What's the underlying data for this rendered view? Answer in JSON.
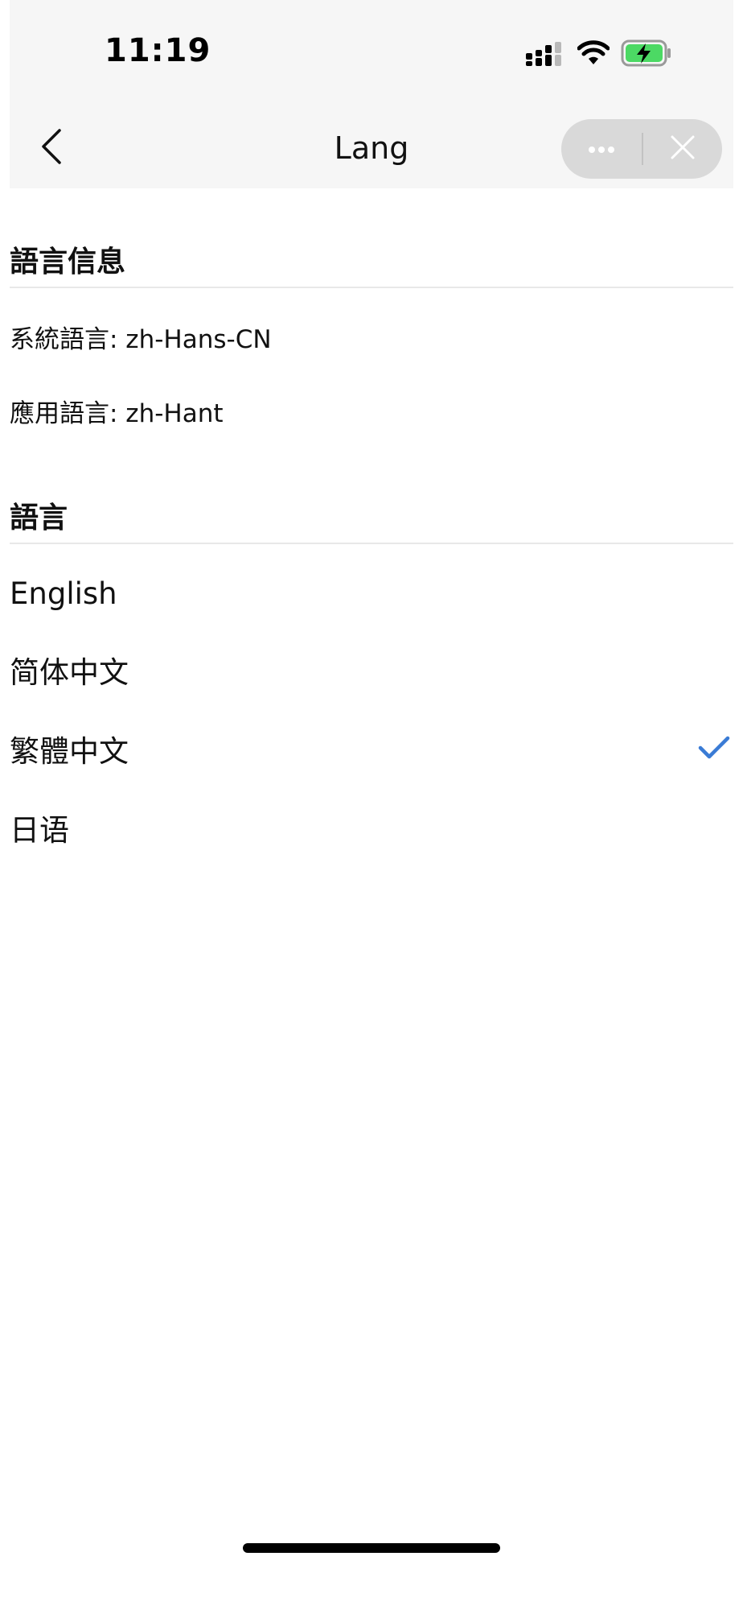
{
  "status_bar": {
    "time": "11:19",
    "icons": [
      "signal-icon",
      "wifi-icon",
      "battery-charging-icon"
    ],
    "battery_color": "#4cd964"
  },
  "nav": {
    "title": "Lang",
    "back_icon": "chevron-left-icon",
    "more_icon": "more-dots-icon",
    "close_icon": "close-icon"
  },
  "info_section": {
    "title": "語言信息",
    "system_language": "系統語言: zh-Hans-CN",
    "app_language": "應用語言: zh-Hant"
  },
  "language_section": {
    "title": "語言",
    "options": [
      {
        "label": "English",
        "selected": false
      },
      {
        "label": "简体中文",
        "selected": false
      },
      {
        "label": "繁體中文",
        "selected": true
      },
      {
        "label": "日语",
        "selected": false
      }
    ],
    "check_color": "#3a7bd5"
  }
}
